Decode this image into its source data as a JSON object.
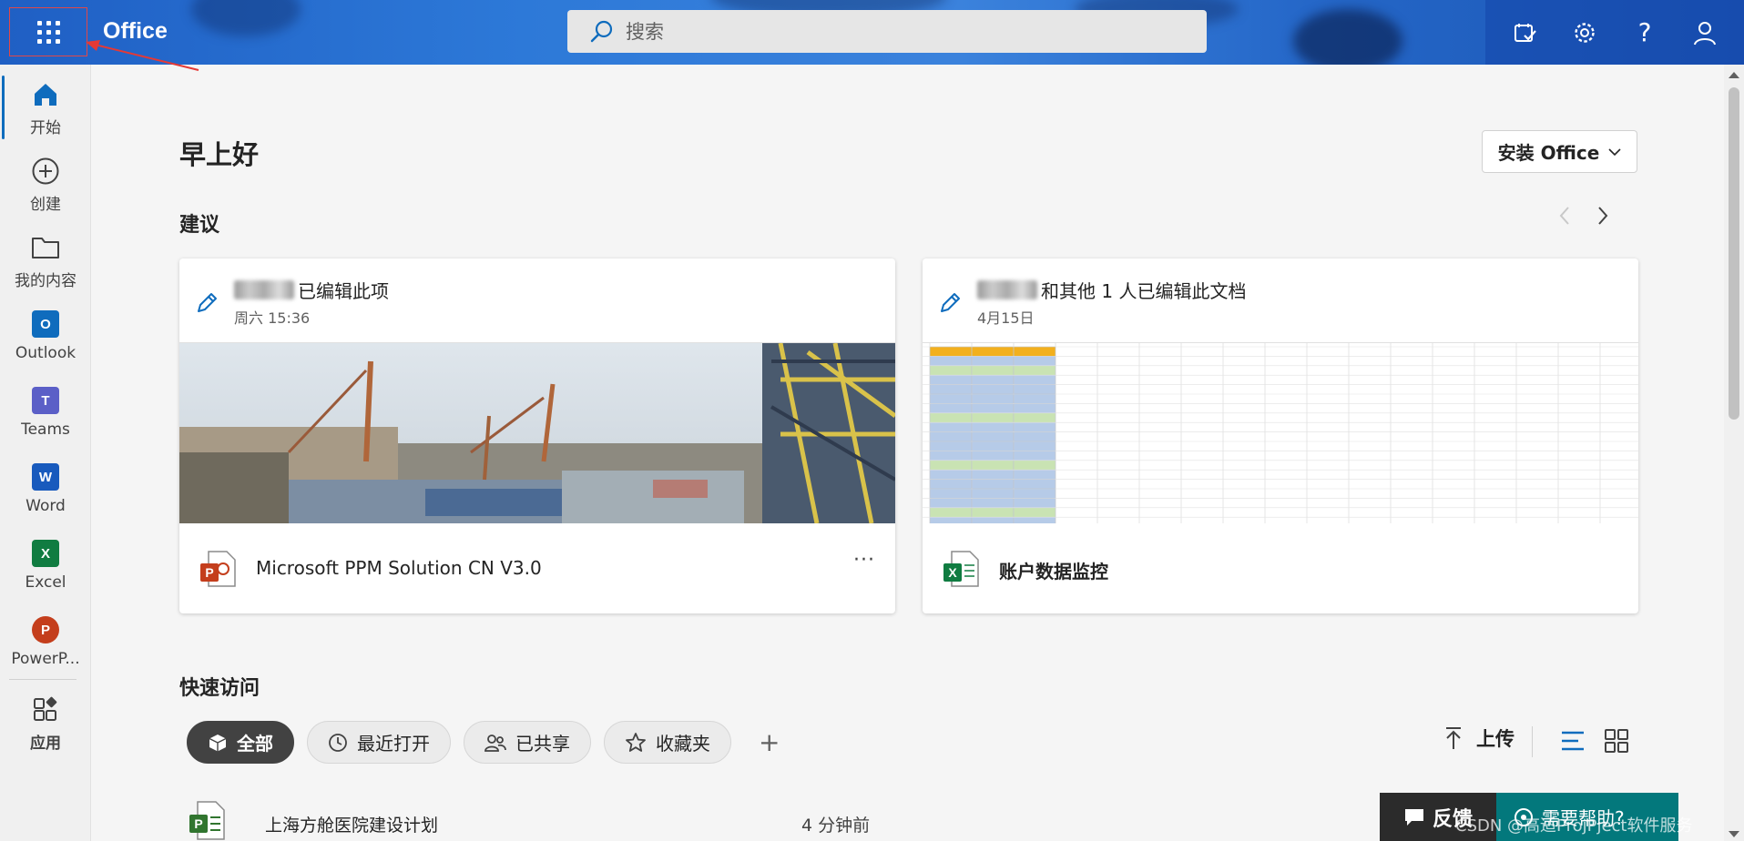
{
  "header": {
    "brand": "Office",
    "search_placeholder": "搜索",
    "icons": [
      "to-do-icon",
      "gear-icon",
      "help-icon",
      "account-icon"
    ],
    "help_symbol": "?"
  },
  "rail": {
    "items": [
      {
        "label": "开始",
        "icon": "home-icon",
        "active": true
      },
      {
        "label": "创建",
        "icon": "plus-circle-icon"
      },
      {
        "label": "我的内容",
        "icon": "folder-icon"
      },
      {
        "label": "Outlook",
        "icon": "outlook-icon",
        "glyph": "O",
        "color": "#0f6cbd"
      },
      {
        "label": "Teams",
        "icon": "teams-icon",
        "glyph": "T",
        "color": "#5b5fc7"
      },
      {
        "label": "Word",
        "icon": "word-icon",
        "glyph": "W",
        "color": "#185abd"
      },
      {
        "label": "Excel",
        "icon": "excel-icon",
        "glyph": "X",
        "color": "#107c41"
      },
      {
        "label": "PowerP...",
        "icon": "powerpoint-icon",
        "glyph": "P",
        "color": "#c43e1c"
      },
      {
        "label": "应用",
        "icon": "apps-icon"
      }
    ]
  },
  "main": {
    "greeting": "早上好",
    "install_label": "安装 Office",
    "suggestions_title": "建议",
    "cards": [
      {
        "action": "已编辑此项",
        "time": "周六 15:36",
        "file_name": "Microsoft PPM Solution CN V3.0",
        "file_type": "powerpoint",
        "file_glyph": "P",
        "more": "···"
      },
      {
        "action": "和其他 1 人已编辑此文档",
        "time": "4月15日",
        "file_name": "账户数据监控",
        "file_type": "excel",
        "file_glyph": "X"
      }
    ],
    "quick_access_title": "快速访问",
    "chips": [
      {
        "label": "全部",
        "icon": "cube-icon",
        "selected": true
      },
      {
        "label": "最近打开",
        "icon": "clock-icon"
      },
      {
        "label": "已共享",
        "icon": "people-icon"
      },
      {
        "label": "收藏夹",
        "icon": "star-icon"
      }
    ],
    "add_label": "+",
    "upload_label": "上传",
    "files": [
      {
        "name": "上海方舱医院建设计划",
        "time": "4 分钟前",
        "type": "project",
        "glyph": "P"
      }
    ]
  },
  "footer": {
    "feedback_label": "反馈",
    "help_label": "需要帮助?",
    "watermark": "CSDN @高适ProjPject软件服务"
  },
  "colors": {
    "accent": "#0f6cbd",
    "header": "#2d79d8",
    "help": "#03787c"
  }
}
